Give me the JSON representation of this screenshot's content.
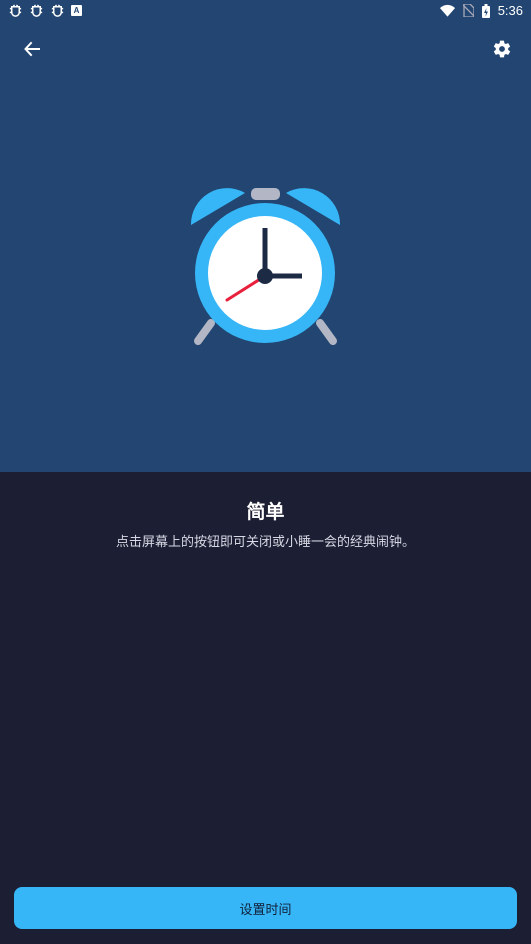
{
  "status_bar": {
    "time": "5:36",
    "left_icons": [
      "bug-icon",
      "bug-icon",
      "bug-icon",
      "a-icon"
    ],
    "a_label": "A",
    "right_icons": [
      "wifi-icon",
      "no-sim-icon",
      "battery-icon"
    ]
  },
  "toolbar": {
    "back_icon": "arrow-back-icon",
    "settings_icon": "gear-icon"
  },
  "content": {
    "title": "简单",
    "description": "点击屏幕上的按钮即可关闭或小睡一会的经典闹钟。"
  },
  "footer": {
    "set_time_label": "设置时间"
  },
  "colors": {
    "header_bg": "#224671",
    "body_bg": "#1c1e33",
    "accent": "#36b6f7",
    "second_hand": "#e8203c"
  }
}
